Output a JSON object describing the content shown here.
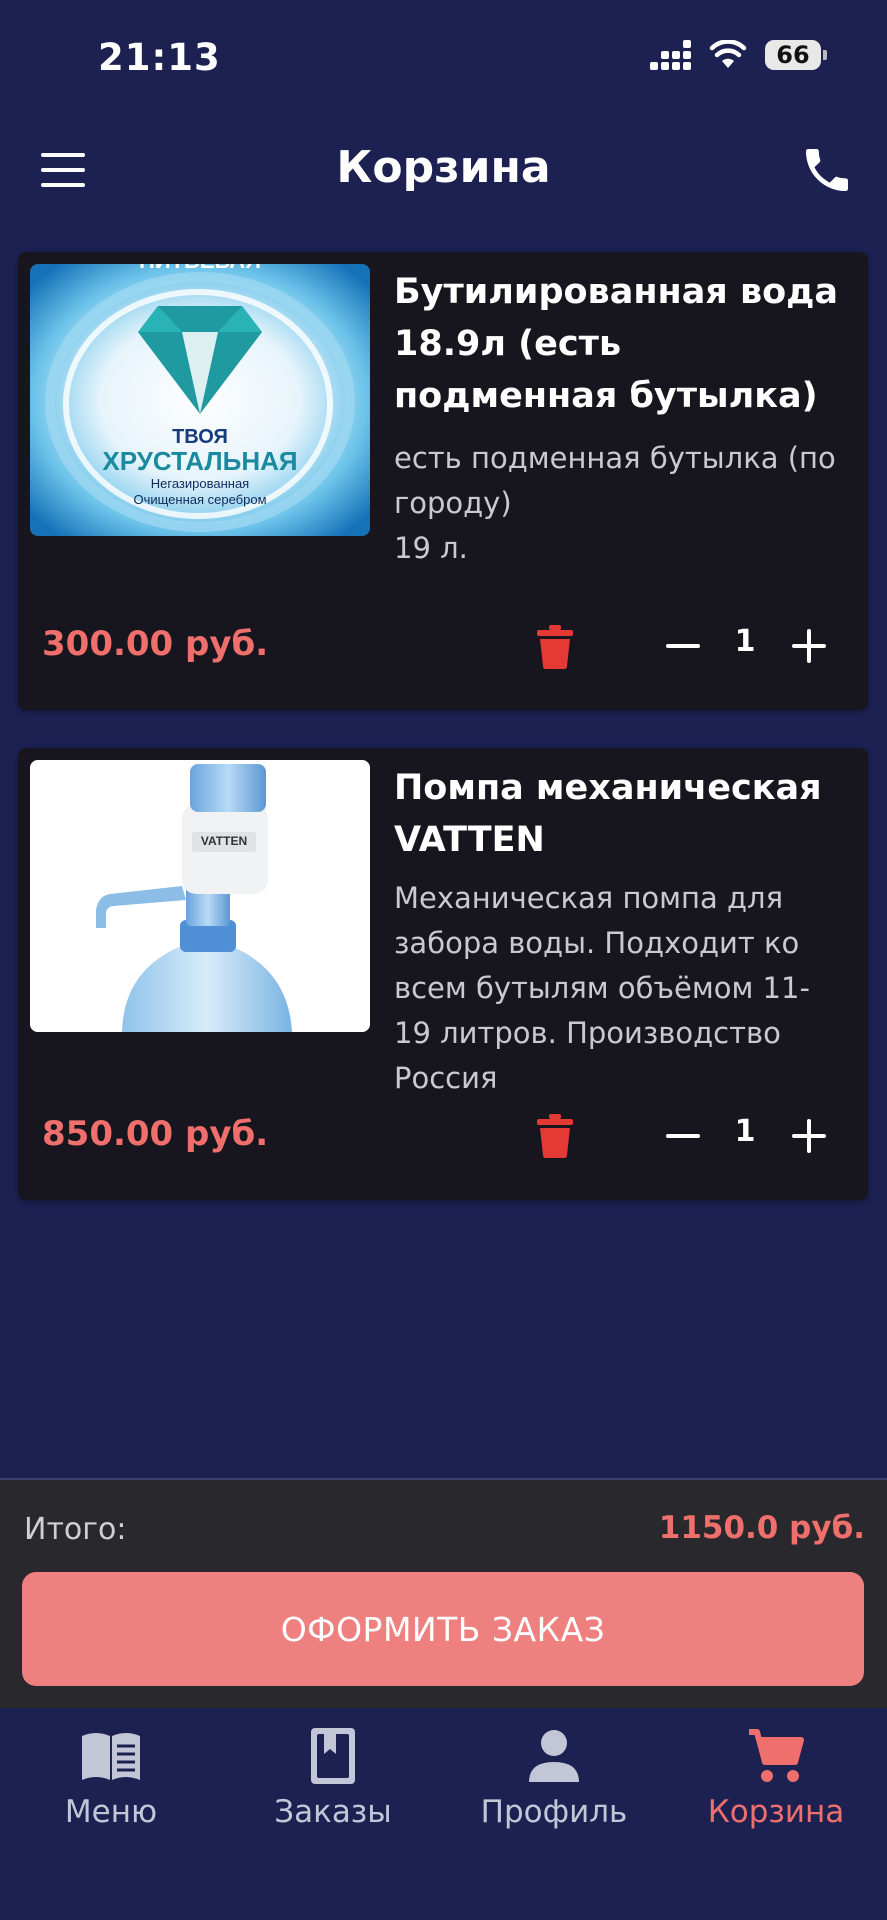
{
  "status_bar": {
    "time": "21:13",
    "battery": "66"
  },
  "header": {
    "title": "Корзина",
    "menu_icon": "hamburger-menu-icon",
    "phone_icon": "phone-icon"
  },
  "cart": {
    "items": [
      {
        "name": "Бутилированная вода 18.9л (есть подменная бутылка)",
        "description": "есть подменная бутылка (по городу)",
        "volume": "19 л.",
        "price": "300.00 руб.",
        "quantity": "1",
        "image": {
          "brand_top": "ПИТЬЕВАЯ",
          "brand_main_1": "ТВОЯ",
          "brand_main_2": "ХРУСТАЛЬНАЯ",
          "brand_sub_1": "Негазированная",
          "brand_sub_2": "Очищенная серебром"
        }
      },
      {
        "name": "Помпа механическая VATTEN",
        "description": "Механическая помпа для забора воды. Подходит ко всем бутылям объёмом 11- 19 литров. Производство Россия",
        "price": "850.00 руб.",
        "quantity": "1",
        "image": {
          "brand": "VATTEN"
        }
      }
    ]
  },
  "summary": {
    "total_label": "Итого:",
    "total_value": "1150.0 руб.",
    "checkout_label": "ОФОРМИТЬ ЗАКАЗ"
  },
  "nav": {
    "menu": "Меню",
    "orders": "Заказы",
    "profile": "Профиль",
    "cart": "Корзина",
    "active": "cart"
  },
  "colors": {
    "background": "#1c2152",
    "card": "#17161e",
    "accent": "#ef6f6c",
    "button": "#ef8080",
    "trash": "#e53935"
  }
}
